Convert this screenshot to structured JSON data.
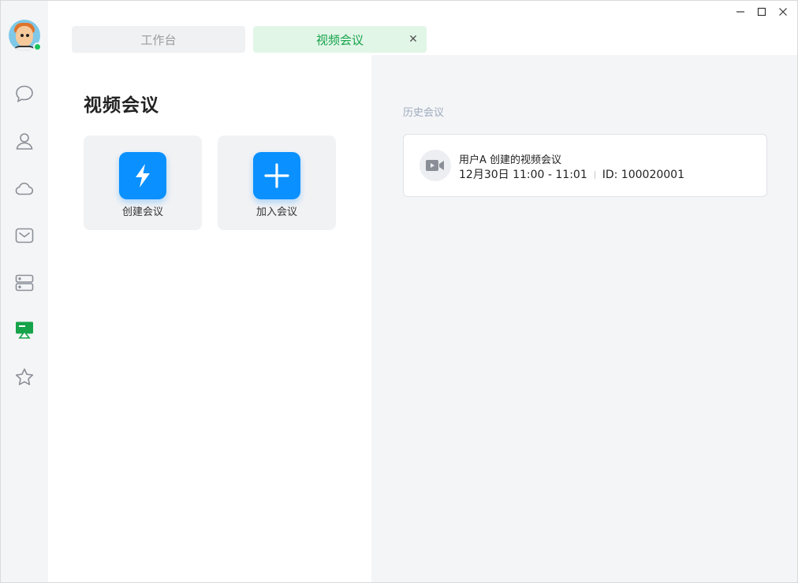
{
  "window": {
    "minimize_label": "–",
    "maximize_label": "□",
    "close_label": "✕"
  },
  "sidebar": {
    "items": [
      {
        "name": "chat-icon",
        "active": false
      },
      {
        "name": "contacts-icon",
        "active": false
      },
      {
        "name": "cloud-icon",
        "active": false
      },
      {
        "name": "mail-icon",
        "active": false
      },
      {
        "name": "server-icon",
        "active": false
      },
      {
        "name": "meeting-icon",
        "active": true
      },
      {
        "name": "star-icon",
        "active": false
      }
    ],
    "status": "online"
  },
  "tabs": [
    {
      "label": "工作台",
      "active": false
    },
    {
      "label": "视频会议",
      "active": true,
      "close_label": "✕"
    }
  ],
  "main": {
    "title": "视频会议",
    "actions": [
      {
        "label": "创建会议",
        "icon": "lightning-icon"
      },
      {
        "label": "加入会议",
        "icon": "plus-icon"
      }
    ]
  },
  "history": {
    "label": "历史会议",
    "items": [
      {
        "title": "用户A 创建的视频会议",
        "time": "12月30日 11:00 - 11:01",
        "id": "ID:  100020001",
        "icon": "video-camera-icon"
      }
    ]
  },
  "colors": {
    "accent_green": "#16a34a",
    "action_blue": "#0a90ff",
    "sidebar_bg": "#f4f5f7"
  }
}
